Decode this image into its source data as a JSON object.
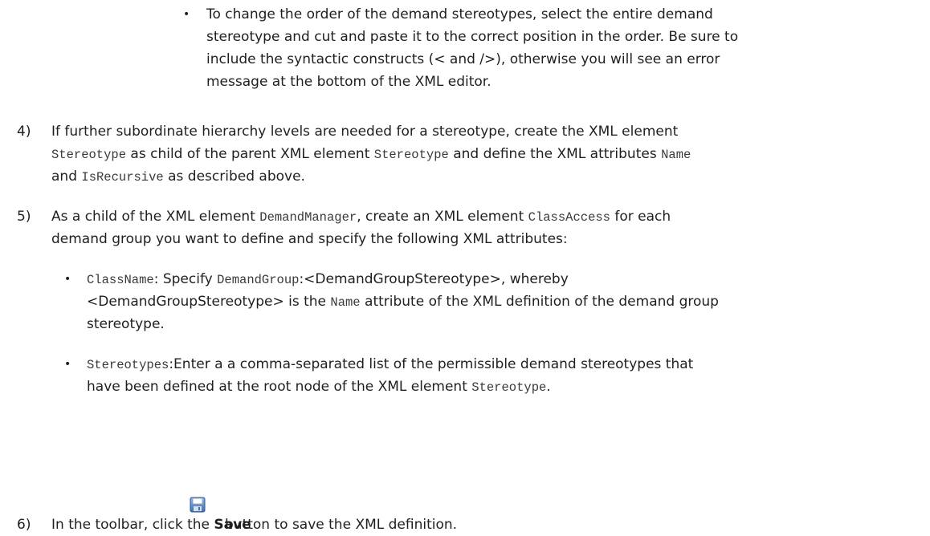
{
  "bullet_order": {
    "l1": "To change the order of the demand stereotypes, select the entire demand",
    "l2": "stereotype and cut and paste it to the correct position in the order. Be sure to",
    "l3": "include the syntactic constructs (< and />), otherwise you will see an error",
    "l4": "message at the bottom of the XML editor."
  },
  "step4": {
    "number": "4)",
    "l1_a": "If further subordinate hierarchy levels are needed for a stereotype, create the XML element",
    "l2_code1": "Stereotype",
    "l2_a": " as child of the parent XML element ",
    "l2_code2": "Stereotype",
    "l2_b": " and define the XML attributes ",
    "l2_code3": "Name",
    "l3_a": "and ",
    "l3_code": "IsRecursive",
    "l3_b": " as described above."
  },
  "step5": {
    "number": "5)",
    "l1_a": "As a child of the XML element ",
    "l1_code1": "DemandManager",
    "l1_b": ", create an XML element ",
    "l1_code2": "ClassAccess",
    "l1_c": " for each",
    "l2": "demand group you want to define and specify the following XML attributes:"
  },
  "bullet_classname": {
    "code1": "ClassName",
    "a": ": Specify ",
    "code2": "DemandGroup",
    "b": ":<DemandGroupStereotype>, whereby",
    "l2_a": "<DemandGroupStereotype> is the ",
    "l2_code": "Name",
    "l2_b": " attribute of the XML definition of the demand group",
    "l3": "stereotype."
  },
  "bullet_stereotypes": {
    "code1": "Stereotypes",
    "a": ":Enter a a comma-separated list of the permissible demand stereotypes that",
    "l2_a": "have been defined at the root node of the XML element ",
    "l2_code": "Stereotype",
    "l2_b": "."
  },
  "step6": {
    "number": "6)",
    "a": "In the toolbar, click the ",
    "bold": "Save",
    "b": "button to save the XML definition.",
    "icon": "save-icon"
  }
}
